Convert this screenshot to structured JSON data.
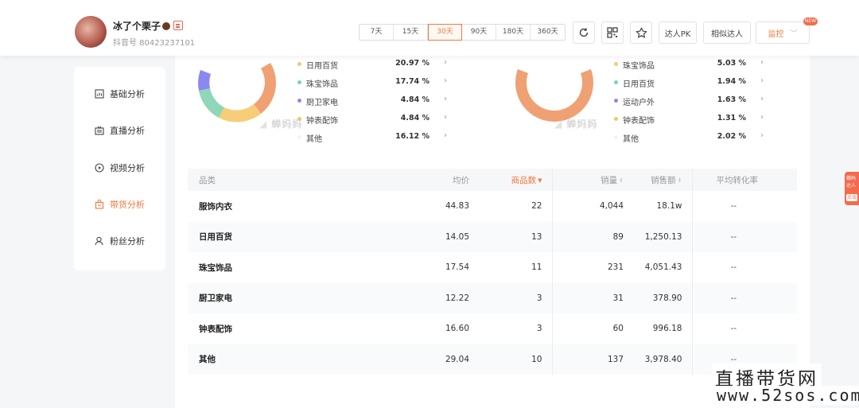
{
  "header": {
    "user_name": "冰了个栗子",
    "user_id": "抖音号 80423237101",
    "ranges": [
      "7天",
      "15天",
      "30天",
      "90天",
      "180天",
      "360天"
    ],
    "active_range": "30天",
    "pk_label": "达人PK",
    "similar_label": "相似达人",
    "monitor_label": "监控",
    "new_tag": "NEW"
  },
  "sidebar": {
    "items": [
      {
        "label": "基础分析",
        "icon": "chart-icon"
      },
      {
        "label": "直播分析",
        "icon": "tv-icon"
      },
      {
        "label": "视频分析",
        "icon": "play-icon"
      },
      {
        "label": "带货分析",
        "icon": "bag-icon"
      },
      {
        "label": "粉丝分析",
        "icon": "user-icon"
      }
    ],
    "active": "带货分析"
  },
  "left_donut": {
    "watermark": "蝉妈妈",
    "legend": [
      {
        "label": "日用百货",
        "value": "20.97 %",
        "color": "#f7c96a"
      },
      {
        "label": "珠宝饰品",
        "value": "17.74 %",
        "color": "#7fd3b0"
      },
      {
        "label": "厨卫家电",
        "value": "4.84 %",
        "color": "#8b88f0"
      },
      {
        "label": "钟表配饰",
        "value": "4.84 %",
        "color": "#f0c66a"
      },
      {
        "label": "其他",
        "value": "16.12 %",
        "color": "#f3f3f3"
      }
    ]
  },
  "right_donut": {
    "watermark": "蝉妈妈",
    "legend": [
      {
        "label": "珠宝饰品",
        "value": "5.03 %",
        "color": "#f7c96a"
      },
      {
        "label": "日用百货",
        "value": "1.94 %",
        "color": "#7fd3b0"
      },
      {
        "label": "运动户外",
        "value": "1.63 %",
        "color": "#8b88f0"
      },
      {
        "label": "钟表配饰",
        "value": "1.31 %",
        "color": "#f0c66a"
      },
      {
        "label": "其他",
        "value": "2.02 %",
        "color": "#f3f3f3"
      }
    ]
  },
  "table": {
    "headers": [
      "品类",
      "均价",
      "商品数",
      "销量",
      "销售额",
      "平均转化率"
    ],
    "rows": [
      [
        "服饰内衣",
        "44.83",
        "22",
        "4,044",
        "18.1w",
        "--"
      ],
      [
        "日用百货",
        "14.05",
        "13",
        "89",
        "1,250.13",
        "--"
      ],
      [
        "珠宝饰品",
        "17.54",
        "11",
        "231",
        "4,051.43",
        "--"
      ],
      [
        "厨卫家电",
        "12.22",
        "3",
        "31",
        "378.90",
        "--"
      ],
      [
        "钟表配饰",
        "16.60",
        "3",
        "60",
        "996.18",
        "--"
      ],
      [
        "其他",
        "29.04",
        "10",
        "137",
        "3,978.40",
        "--"
      ]
    ]
  },
  "float_side": {
    "line1": "蝉妈",
    "line2": "达人",
    "line3": "点击"
  },
  "site_watermark": {
    "line1": "直播带货网",
    "line2": "www.52sos.com"
  }
}
